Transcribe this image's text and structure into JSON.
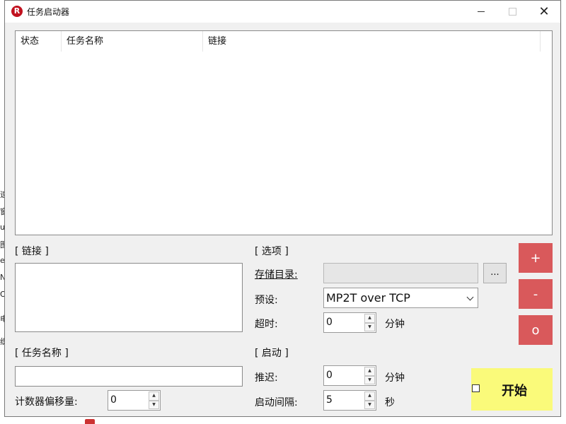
{
  "window": {
    "title": "任务启动器"
  },
  "table": {
    "columns": [
      "状态",
      "任务名称",
      "链接"
    ]
  },
  "link_section": {
    "header": "[ 链接 ]",
    "value": ""
  },
  "name_section": {
    "header": "[ 任务名称 ]",
    "value": ""
  },
  "counter_offset": {
    "label": "计数器偏移量:",
    "value": "0"
  },
  "options": {
    "header": "[ 选项 ]",
    "storage_dir_label": "存储目录:",
    "storage_dir_value": "",
    "browse_label": "...",
    "preset_label": "预设:",
    "preset_value": "MP2T over TCP",
    "timeout_label": "超时:",
    "timeout_value": "0",
    "timeout_unit": "分钟"
  },
  "launch": {
    "header": "[ 启动 ]",
    "delay_label": "推迟:",
    "delay_value": "0",
    "delay_unit": "分钟",
    "interval_label": "启动间隔:",
    "interval_value": "5",
    "interval_unit": "秒"
  },
  "side_buttons": {
    "add": "+",
    "remove": "-",
    "other": "o"
  },
  "start": {
    "label": "开始",
    "checked": false
  },
  "background_fragments": [
    "速",
    "窗",
    "ut",
    "图",
    "e&",
    "N",
    "O",
    "电",
    "织"
  ]
}
